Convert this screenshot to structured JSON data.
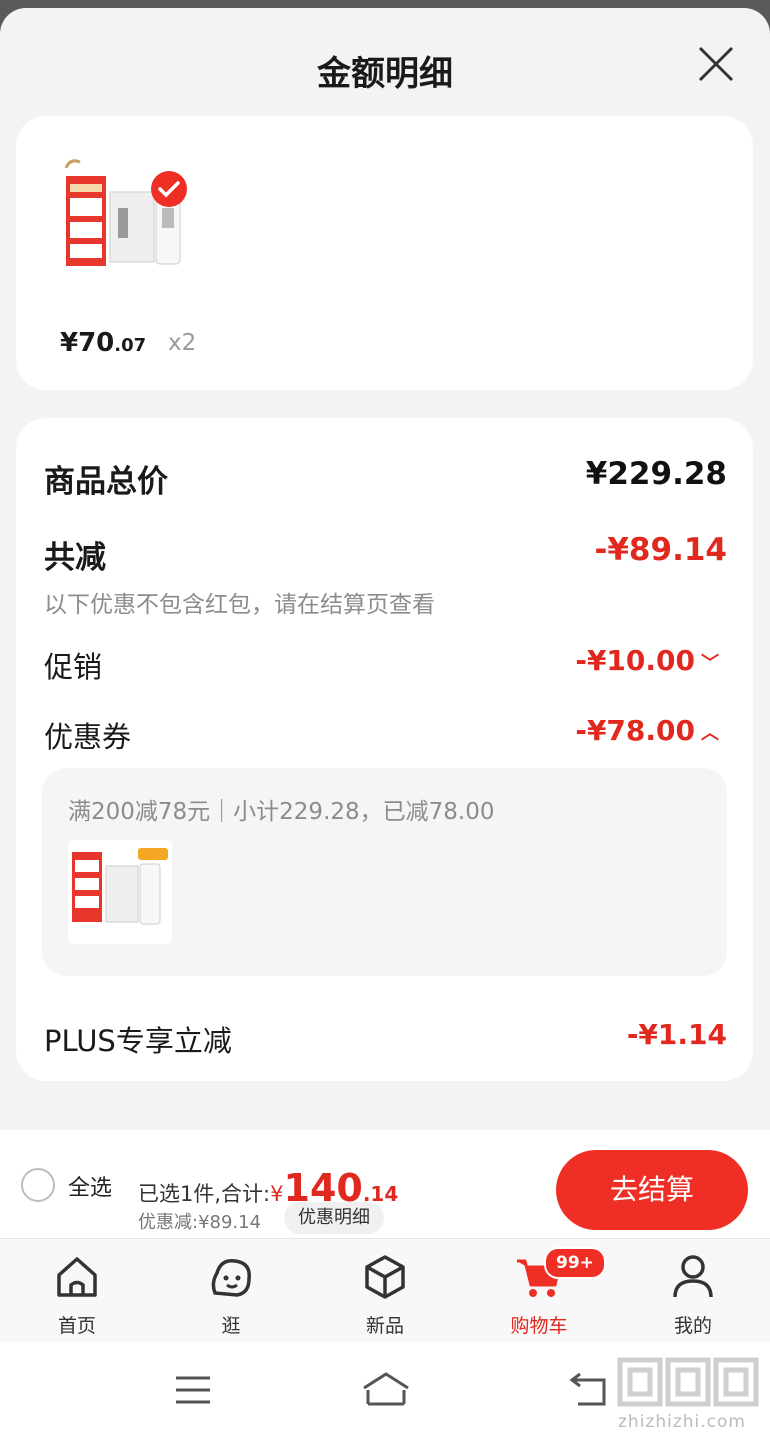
{
  "modal": {
    "title": "金额明细"
  },
  "product": {
    "price_int": "¥70",
    "price_dec": ".07",
    "qty": "x2"
  },
  "breakdown": {
    "total_label": "商品总价",
    "total_value": "¥229.28",
    "reduce_label": "共减",
    "reduce_value": "-¥89.14",
    "note": "以下优惠不包含红包，请在结算页查看",
    "promo_label": "促销",
    "promo_value": "-¥10.00",
    "coupon_label": "优惠券",
    "coupon_value": "-¥78.00",
    "coupon_detail": "满200减78元｜小计229.28，已减78.00",
    "plus_label": "PLUS专享立减",
    "plus_value": "-¥1.14"
  },
  "footer": {
    "select_all": "全选",
    "selected_text": "已选1件,合计:",
    "yen": "¥",
    "amount_int": "140",
    "amount_dec": ".14",
    "discount_text": "优惠减:¥89.14",
    "discount_btn": "优惠明细",
    "checkout": "去结算"
  },
  "tabs": [
    {
      "label": "首页",
      "icon": "home-icon"
    },
    {
      "label": "逛",
      "icon": "browse-face-icon"
    },
    {
      "label": "新品",
      "icon": "cube-icon"
    },
    {
      "label": "购物车",
      "icon": "cart-icon",
      "badge": "99+",
      "active": true
    },
    {
      "label": "我的",
      "icon": "person-icon"
    }
  ],
  "watermark": {
    "text": "zhizhizhi.com",
    "logo": "值值值"
  },
  "colors": {
    "accent": "#ef2f25",
    "price_red": "#e0281f",
    "sheet_bg": "#f3f3f3"
  }
}
